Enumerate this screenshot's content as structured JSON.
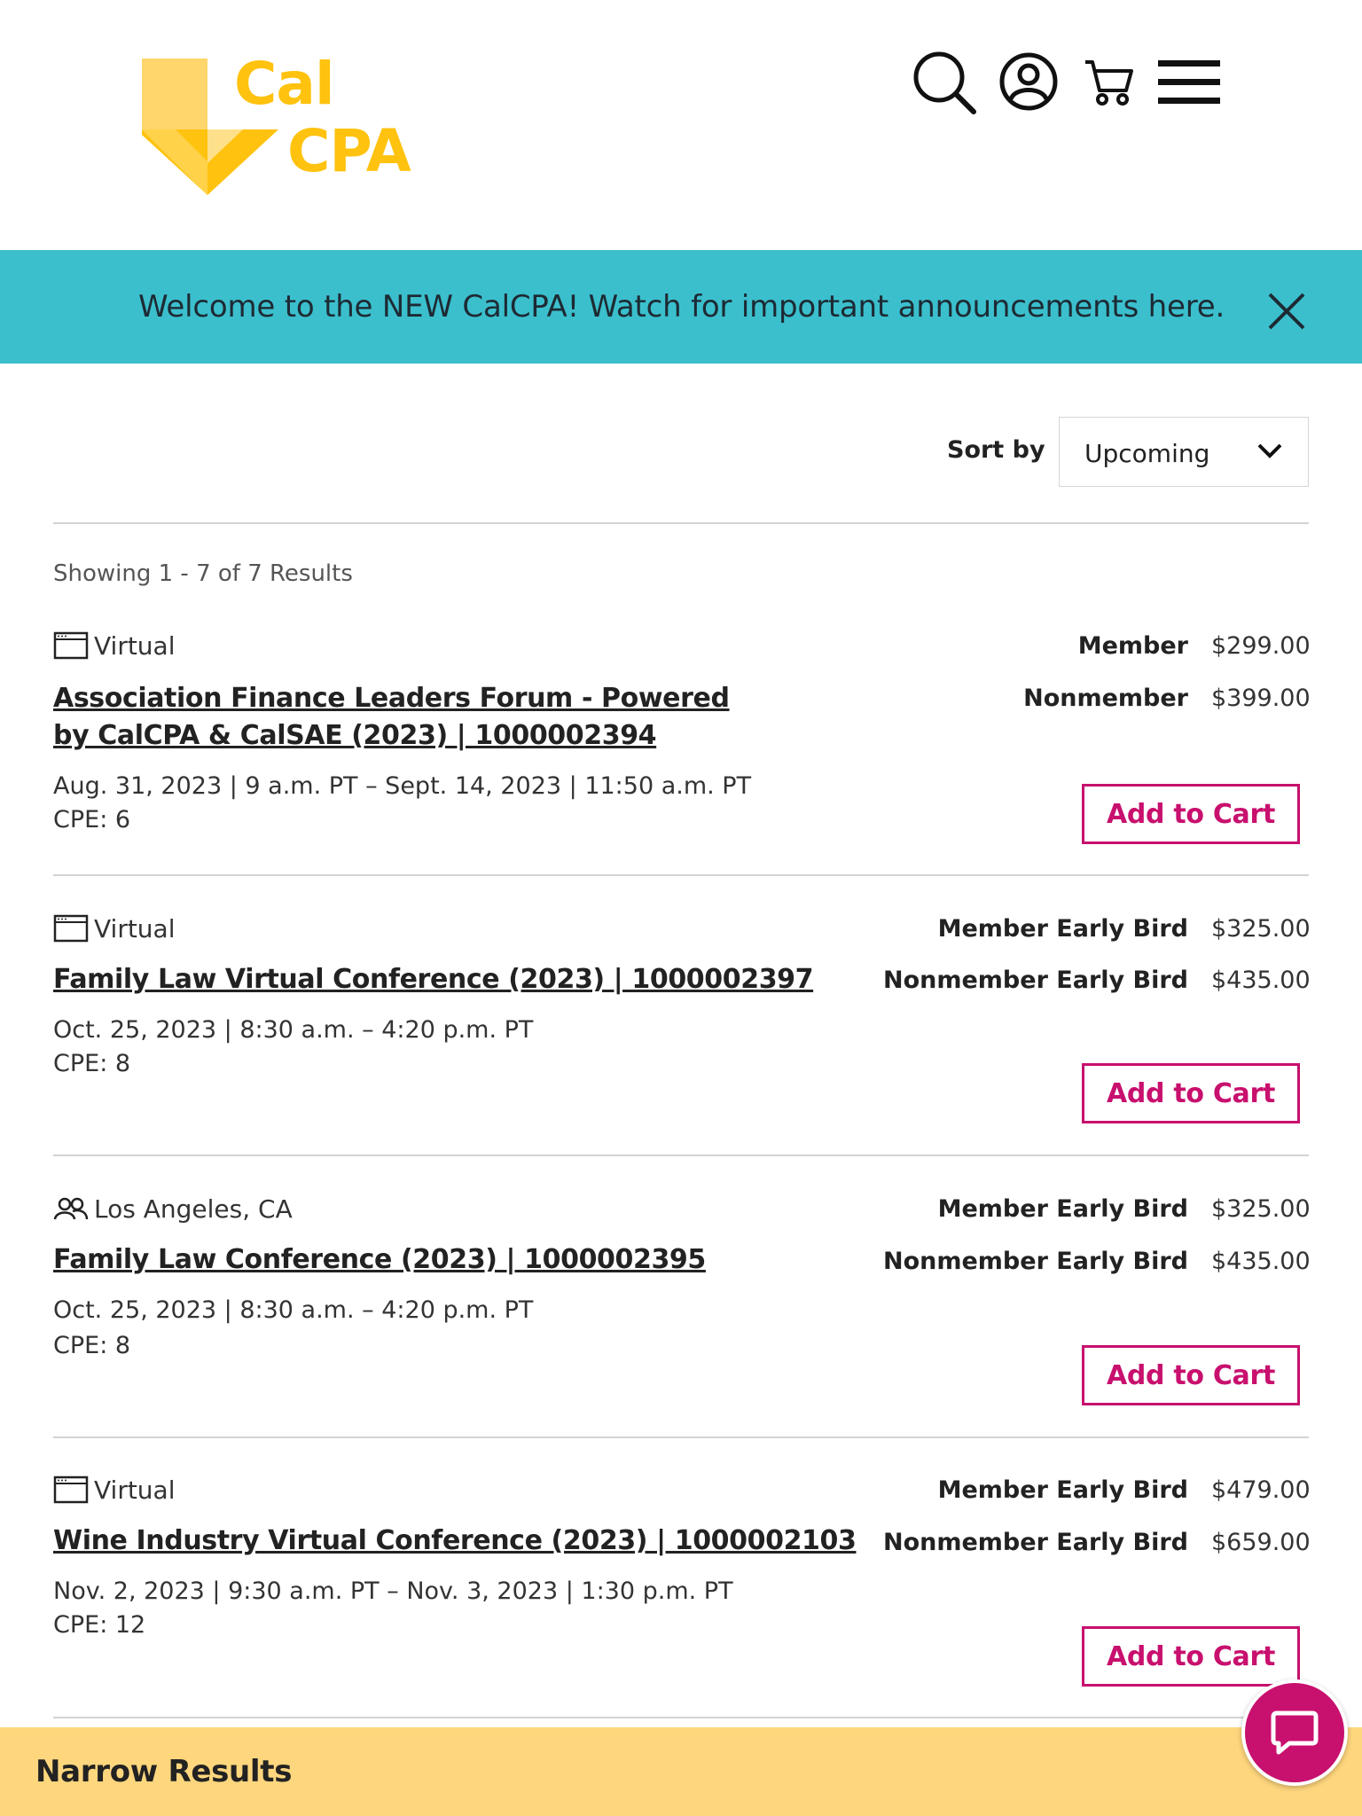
{
  "brand": {
    "logo_text_line1": "Cal",
    "logo_text_line2": "CPA",
    "logo_color": "#FFC20E",
    "accent_color": "#C8106E",
    "banner_color": "#3BBFCD",
    "narrow_bar_color": "#FED67D"
  },
  "header": {
    "icons": [
      "search-icon",
      "account-icon",
      "cart-icon",
      "menu-icon"
    ]
  },
  "banner": {
    "text": "Welcome to the NEW CalCPA! Watch for important announcements here.",
    "close_icon": "close-icon"
  },
  "sort": {
    "label": "Sort by",
    "selected": "Upcoming"
  },
  "results": {
    "count_text": "Showing 1 - 7 of 7 Results",
    "items": [
      {
        "location_icon": "browser-icon",
        "location": "Virtual",
        "title": "Association Finance Leaders Forum - Powered by CalCPA & CalSAE (2023) | 1000002394",
        "date": "Aug. 31, 2023 | 9 a.m. PT – Sept. 14, 2023 | 11:50 a.m. PT",
        "cpe": "CPE: 6",
        "prices": [
          {
            "label": "Member",
            "value": "$299.00"
          },
          {
            "label": "Nonmember",
            "value": "$399.00"
          }
        ],
        "button": "Add to Cart"
      },
      {
        "location_icon": "browser-icon",
        "location": "Virtual",
        "title": "Family Law Virtual Conference (2023) | 1000002397",
        "date": "Oct. 25, 2023 | 8:30 a.m. – 4:20 p.m. PT",
        "cpe": "CPE: 8",
        "prices": [
          {
            "label": "Member Early Bird",
            "value": "$325.00"
          },
          {
            "label": "Nonmember Early Bird",
            "value": "$435.00"
          }
        ],
        "button": "Add to Cart"
      },
      {
        "location_icon": "people-icon",
        "location": "Los Angeles, CA",
        "title": "Family Law Conference (2023) | 1000002395",
        "date": "Oct. 25, 2023 | 8:30 a.m. – 4:20 p.m. PT",
        "cpe": "CPE: 8",
        "prices": [
          {
            "label": "Member Early Bird",
            "value": "$325.00"
          },
          {
            "label": "Nonmember Early Bird",
            "value": "$435.00"
          }
        ],
        "button": "Add to Cart"
      },
      {
        "location_icon": "browser-icon",
        "location": "Virtual",
        "title": "Wine Industry Virtual Conference (2023) | 1000002103",
        "date": "Nov. 2, 2023 | 9:30 a.m. PT – Nov. 3, 2023 | 1:30 p.m. PT",
        "cpe": "CPE: 12",
        "prices": [
          {
            "label": "Member Early Bird",
            "value": "$479.00"
          },
          {
            "label": "Nonmember Early Bird",
            "value": "$659.00"
          }
        ],
        "button": "Add to Cart"
      }
    ]
  },
  "narrow": {
    "label": "Narrow Results"
  },
  "chat": {
    "icon": "chat-icon"
  }
}
